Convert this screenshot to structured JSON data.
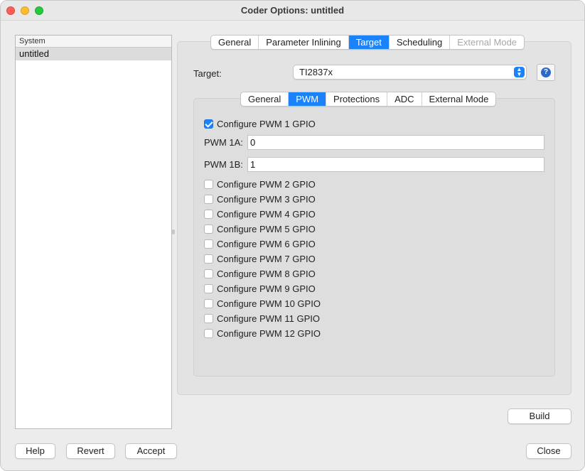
{
  "window": {
    "title": "Coder Options: untitled"
  },
  "tree": {
    "header": "System",
    "items": [
      "untitled"
    ]
  },
  "outer_tabs": [
    {
      "label": "General",
      "state": "normal"
    },
    {
      "label": "Parameter Inlining",
      "state": "normal"
    },
    {
      "label": "Target",
      "state": "active"
    },
    {
      "label": "Scheduling",
      "state": "normal"
    },
    {
      "label": "External Mode",
      "state": "disabled"
    }
  ],
  "target": {
    "label": "Target:",
    "value": "TI2837x",
    "help_icon": "question-icon"
  },
  "inner_tabs": [
    {
      "label": "General",
      "state": "normal"
    },
    {
      "label": "PWM",
      "state": "active"
    },
    {
      "label": "Protections",
      "state": "normal"
    },
    {
      "label": "ADC",
      "state": "normal"
    },
    {
      "label": "External Mode",
      "state": "normal"
    }
  ],
  "pwm1": {
    "label": "Configure PWM 1 GPIO",
    "checked": true,
    "a_label": "PWM 1A:",
    "a_value": "0",
    "b_label": "PWM 1B:",
    "b_value": "1"
  },
  "pwm_options": [
    {
      "label": "Configure PWM 2 GPIO",
      "checked": false
    },
    {
      "label": "Configure PWM 3 GPIO",
      "checked": false
    },
    {
      "label": "Configure PWM 4 GPIO",
      "checked": false
    },
    {
      "label": "Configure PWM 5 GPIO",
      "checked": false
    },
    {
      "label": "Configure PWM 6 GPIO",
      "checked": false
    },
    {
      "label": "Configure PWM 7 GPIO",
      "checked": false
    },
    {
      "label": "Configure PWM 8 GPIO",
      "checked": false
    },
    {
      "label": "Configure PWM 9 GPIO",
      "checked": false
    },
    {
      "label": "Configure PWM 10 GPIO",
      "checked": false
    },
    {
      "label": "Configure PWM 11 GPIO",
      "checked": false
    },
    {
      "label": "Configure PWM 12 GPIO",
      "checked": false
    }
  ],
  "buttons": {
    "build": "Build",
    "help": "Help",
    "revert": "Revert",
    "accept": "Accept",
    "close": "Close"
  },
  "colors": {
    "accent": "#1a82fb",
    "window_bg": "#ececec",
    "panel_bg": "#e3e3e3"
  }
}
